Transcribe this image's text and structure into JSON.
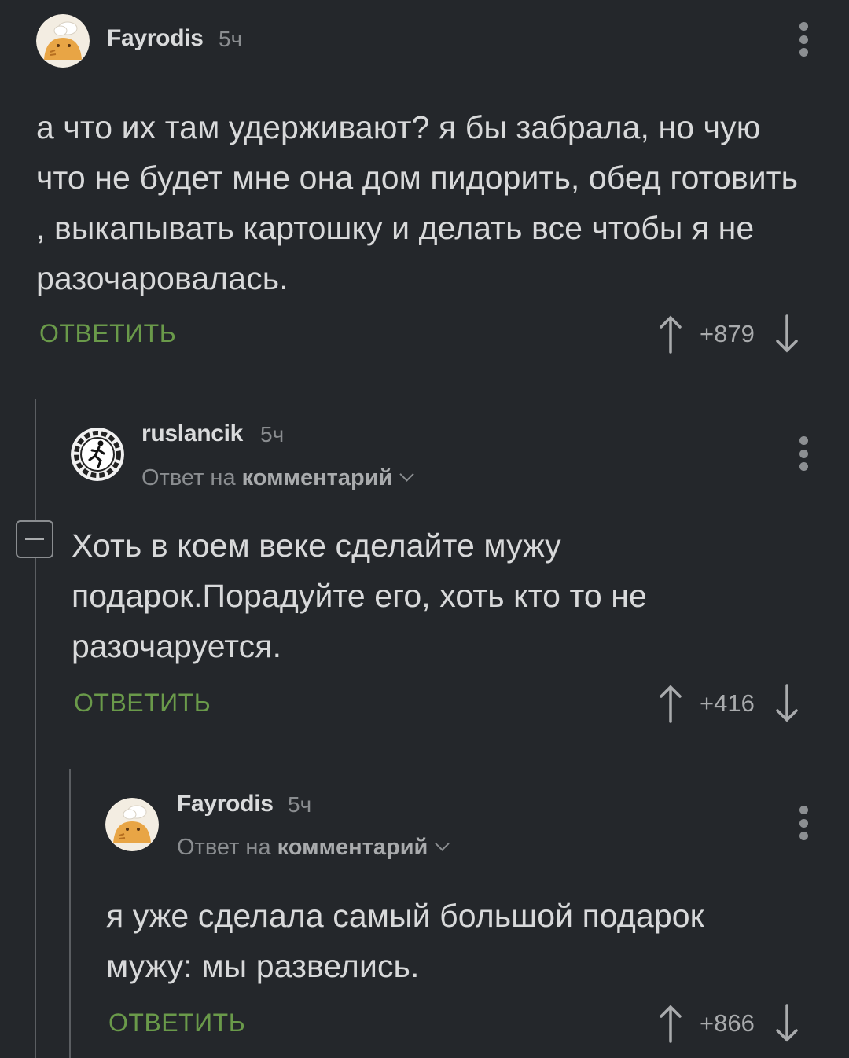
{
  "comments": [
    {
      "username": "Fayrodis",
      "time": "5ч",
      "avatar_icon": "chef-cat-avatar-icon",
      "text": "а что их там удерживают? я бы забрала, но чую что не будет мне она дом пидорить, обед готовить , выкапывать картошку и делать все чтобы я не разочаровалась.",
      "reply_label": "ОТВЕТИТЬ",
      "score": "+879"
    },
    {
      "username": "ruslancik",
      "time": "5ч",
      "avatar_icon": "running-man-gear-avatar-icon",
      "reply_to_prefix": "Ответ на",
      "reply_to_target": "комментарий",
      "text": "Хоть в коем веке сделайте мужу подарок.Порадуйте его, хоть кто то не разочаруется.",
      "reply_label": "ОТВЕТИТЬ",
      "score": "+416"
    },
    {
      "username": "Fayrodis",
      "time": "5ч",
      "avatar_icon": "chef-cat-avatar-icon",
      "reply_to_prefix": "Ответ на",
      "reply_to_target": "комментарий",
      "text": "я уже сделала самый большой подарок мужу: мы развелись.",
      "reply_label": "ОТВЕТИТЬ",
      "score": "+866"
    }
  ],
  "colors": {
    "background": "#24272b",
    "text": "#d8d9da",
    "reply_green": "#6a9a4a",
    "muted": "#8a8d90"
  }
}
